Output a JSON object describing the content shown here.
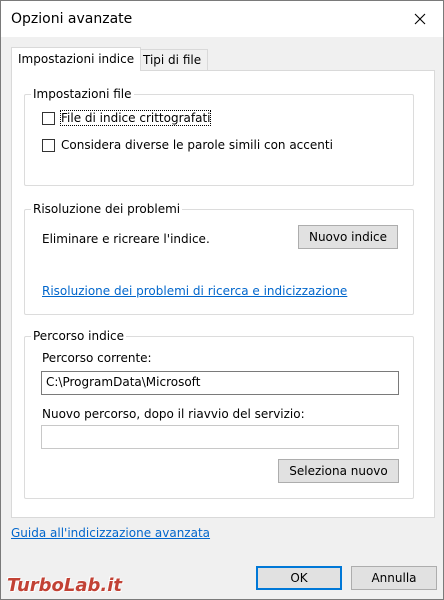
{
  "window": {
    "title": "Opzioni avanzate",
    "close_icon": "close-icon"
  },
  "tabs": [
    {
      "label": "Impostazioni indice",
      "active": true
    },
    {
      "label": "Tipi di file",
      "active": false
    }
  ],
  "file_settings": {
    "legend": "Impostazioni file",
    "checkbox1_label": "File di indice crittografati",
    "checkbox1_checked": false,
    "checkbox2_label": "Considera diverse le parole simili con accenti",
    "checkbox2_checked": false
  },
  "troubleshooting": {
    "legend": "Risoluzione dei problemi",
    "description": "Eliminare e ricreare l'indice.",
    "rebuild_button": "Nuovo indice",
    "link": "Risoluzione dei problemi di ricerca e indicizzazione"
  },
  "index_location": {
    "legend": "Percorso indice",
    "current_label": "Percorso corrente:",
    "current_value": "C:\\ProgramData\\Microsoft",
    "new_label": "Nuovo percorso, dopo il riavvio del servizio:",
    "new_value": "",
    "select_button": "Seleziona nuovo"
  },
  "footer": {
    "help_link": "Guida all'indicizzazione avanzata",
    "ok_button": "OK",
    "cancel_button": "Annulla"
  },
  "watermark": "TurboLab.it"
}
